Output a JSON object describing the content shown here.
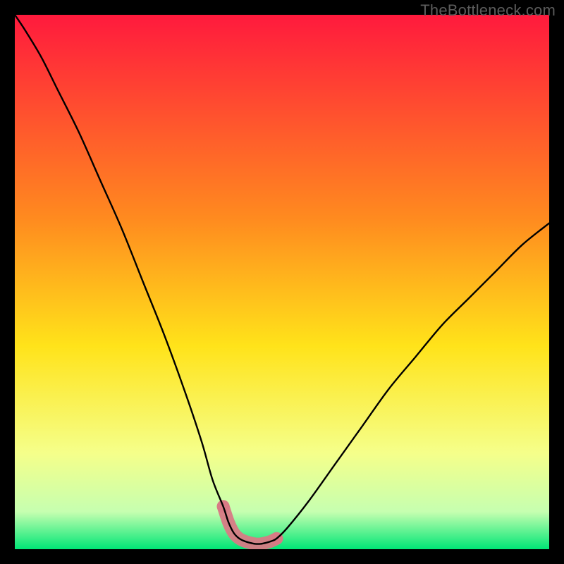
{
  "watermark": "TheBottleneck.com",
  "colors": {
    "bg": "#000000",
    "grad_top": "#ff1a3d",
    "grad_mid1": "#ff8a1f",
    "grad_mid2": "#ffe31a",
    "grad_mid3": "#f5ff8a",
    "grad_mid4": "#c6ffb0",
    "grad_bottom": "#00e676",
    "line": "#000000",
    "accent": "#d87a85"
  },
  "chart_data": {
    "type": "line",
    "title": "",
    "xlabel": "",
    "ylabel": "",
    "xlim": [
      0,
      100
    ],
    "ylim": [
      0,
      100
    ],
    "x": [
      0,
      2,
      5,
      8,
      12,
      16,
      20,
      24,
      28,
      32,
      35,
      37,
      39,
      40,
      41,
      42,
      43,
      44,
      45,
      46,
      47,
      48,
      49,
      51,
      55,
      60,
      65,
      70,
      75,
      80,
      85,
      90,
      95,
      100
    ],
    "values": [
      100,
      97,
      92,
      86,
      78,
      69,
      60,
      50,
      40,
      29,
      20,
      13,
      8,
      5,
      3,
      2,
      1.5,
      1.2,
      1,
      1,
      1.2,
      1.5,
      2,
      4,
      9,
      16,
      23,
      30,
      36,
      42,
      47,
      52,
      57,
      61
    ],
    "note": "x and y are percentages of the plot width/height (origin at bottom-left). Values are read approximately from the curve in the image.",
    "accent_segment": {
      "x_start": 37.5,
      "x_end": 49,
      "description": "Thick pink/salmon overlay near the curve minimum."
    }
  }
}
